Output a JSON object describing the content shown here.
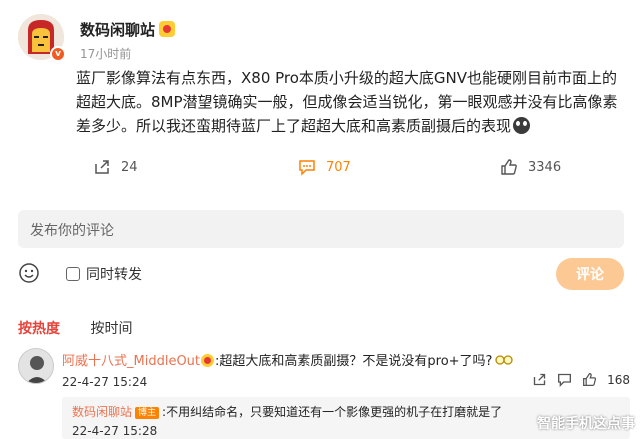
{
  "post": {
    "author": "数码闲聊站",
    "time": "17小时前",
    "text_1": "蓝厂影像算法有点东西，X80 Pro本质小升级的超大底GNV也能硬刚目前市面上的超超大底。8MP潜望镜确实一般，但成像会适当锐化，第一眼观感并没有比高像素差多少。所以我还蛮期待蓝厂上了超超大底和高素质副摄后的表现"
  },
  "actions": {
    "repost_count": "24",
    "comment_count": "707",
    "like_count": "3346"
  },
  "composer": {
    "placeholder": "发布你的评论",
    "simultaneous_repost_label": "同时转发",
    "submit_label": "评论"
  },
  "sort": {
    "hot": "按热度",
    "time": "按时间"
  },
  "comments": [
    {
      "user": "阿威十八式_MiddleOut",
      "text": ":超超大底和高素质副摄？不是说没有pro+了吗?",
      "time": "22-4-27 15:24",
      "like_count": "168"
    }
  ],
  "reply": {
    "user": "数码闲聊站",
    "tag": "博主",
    "text": ":不用纠结命名，只要知道还有一个影像更强的机子在打磨就是了",
    "time": "22-4-27 15:28"
  },
  "watermark": "智能手机这点事",
  "colors": {
    "accent_orange": "#ff8200",
    "username": "#eb7350",
    "active_tab": "#e6443b",
    "submit_disabled": "#fcc995"
  },
  "icons": [
    "verified-icon",
    "author-badge-icon",
    "repost-icon",
    "comment-icon",
    "like-icon",
    "emoji-icon",
    "checkbox-icon",
    "glasses-emoji-icon"
  ]
}
